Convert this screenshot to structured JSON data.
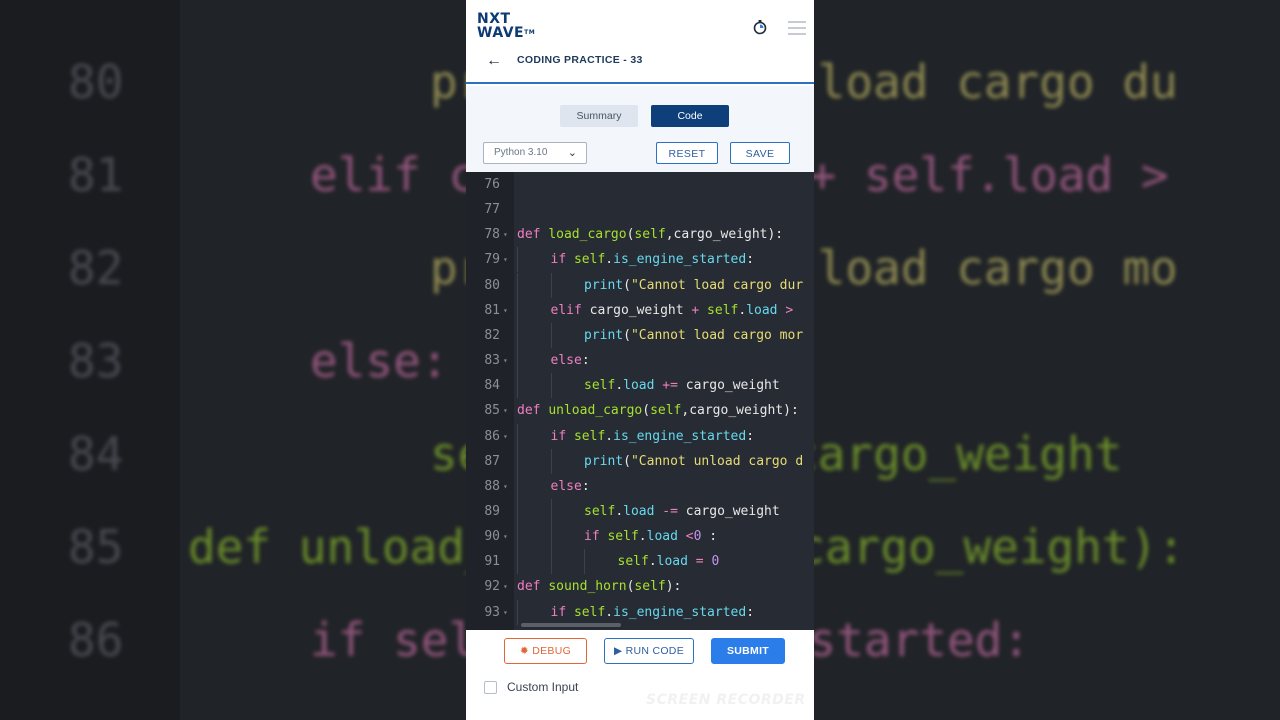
{
  "background_code": [
    {
      "num": "80",
      "code": "print(\"Cannot load cargo du"
    },
    {
      "num": "81",
      "code": "elif cargo_weight + self.load >"
    },
    {
      "num": "82",
      "code": "print(\"Cannot load cargo mo"
    },
    {
      "num": "83",
      "code": "else:"
    },
    {
      "num": "84",
      "code": "self.load += cargo_weight"
    },
    {
      "num": "85",
      "code": "def unload_cargo(self,cargo_weight):"
    },
    {
      "num": "86",
      "code": "if self.is_engine_started:"
    }
  ],
  "header": {
    "logo_top": "NXT",
    "logo_bottom": "WAVE",
    "logo_tm": "TM",
    "page_title": "CODING PRACTICE - 33"
  },
  "tabs": {
    "summary": "Summary",
    "code": "Code",
    "active": "Code"
  },
  "toolbar": {
    "language": "Python 3.10",
    "reset": "RESET",
    "save": "SAVE"
  },
  "editor": {
    "lines": [
      {
        "n": "76",
        "fold": false,
        "indent": 0,
        "tokens": []
      },
      {
        "n": "77",
        "fold": false,
        "indent": 0,
        "tokens": []
      },
      {
        "n": "78",
        "fold": true,
        "indent": 0,
        "tokens": [
          [
            "kw",
            "def "
          ],
          [
            "fn",
            "load_cargo"
          ],
          [
            "plain",
            "("
          ],
          [
            "self",
            "self"
          ],
          [
            "plain",
            ",cargo_weight):"
          ]
        ]
      },
      {
        "n": "79",
        "fold": true,
        "indent": 1,
        "tokens": [
          [
            "kw",
            "if "
          ],
          [
            "self",
            "self"
          ],
          [
            "plain",
            "."
          ],
          [
            "attr",
            "is_engine_started"
          ],
          [
            "plain",
            ":"
          ]
        ]
      },
      {
        "n": "80",
        "fold": false,
        "indent": 2,
        "tokens": [
          [
            "attr",
            "print"
          ],
          [
            "plain",
            "("
          ],
          [
            "str",
            "\"Cannot load cargo dur"
          ]
        ]
      },
      {
        "n": "81",
        "fold": true,
        "indent": 1,
        "tokens": [
          [
            "kw",
            "elif "
          ],
          [
            "plain",
            "cargo_weight "
          ],
          [
            "op",
            "+ "
          ],
          [
            "self",
            "self"
          ],
          [
            "plain",
            "."
          ],
          [
            "attr",
            "load"
          ],
          [
            "op",
            " >"
          ]
        ]
      },
      {
        "n": "82",
        "fold": false,
        "indent": 2,
        "tokens": [
          [
            "attr",
            "print"
          ],
          [
            "plain",
            "("
          ],
          [
            "str",
            "\"Cannot load cargo mor"
          ]
        ]
      },
      {
        "n": "83",
        "fold": true,
        "indent": 1,
        "tokens": [
          [
            "kw",
            "else"
          ],
          [
            "plain",
            ":"
          ]
        ]
      },
      {
        "n": "84",
        "fold": false,
        "indent": 2,
        "tokens": [
          [
            "self",
            "self"
          ],
          [
            "plain",
            "."
          ],
          [
            "attr",
            "load "
          ],
          [
            "op",
            "+= "
          ],
          [
            "plain",
            "cargo_weight"
          ]
        ]
      },
      {
        "n": "85",
        "fold": true,
        "indent": 0,
        "tokens": [
          [
            "kw",
            "def "
          ],
          [
            "fn",
            "unload_cargo"
          ],
          [
            "plain",
            "("
          ],
          [
            "self",
            "self"
          ],
          [
            "plain",
            ",cargo_weight):"
          ]
        ]
      },
      {
        "n": "86",
        "fold": true,
        "indent": 1,
        "tokens": [
          [
            "kw",
            "if "
          ],
          [
            "self",
            "self"
          ],
          [
            "plain",
            "."
          ],
          [
            "attr",
            "is_engine_started"
          ],
          [
            "plain",
            ":"
          ]
        ]
      },
      {
        "n": "87",
        "fold": false,
        "indent": 2,
        "tokens": [
          [
            "attr",
            "print"
          ],
          [
            "plain",
            "("
          ],
          [
            "str",
            "\"Cannot unload cargo d"
          ]
        ]
      },
      {
        "n": "88",
        "fold": true,
        "indent": 1,
        "tokens": [
          [
            "kw",
            "else"
          ],
          [
            "plain",
            ":"
          ]
        ]
      },
      {
        "n": "89",
        "fold": false,
        "indent": 2,
        "tokens": [
          [
            "self",
            "self"
          ],
          [
            "plain",
            "."
          ],
          [
            "attr",
            "load "
          ],
          [
            "op",
            "-= "
          ],
          [
            "plain",
            "cargo_weight"
          ]
        ]
      },
      {
        "n": "90",
        "fold": true,
        "indent": 2,
        "tokens": [
          [
            "kw",
            "if "
          ],
          [
            "self",
            "self"
          ],
          [
            "plain",
            "."
          ],
          [
            "attr",
            "load "
          ],
          [
            "op",
            "<"
          ],
          [
            "num",
            "0"
          ],
          [
            "plain",
            " :"
          ]
        ]
      },
      {
        "n": "91",
        "fold": false,
        "indent": 3,
        "tokens": [
          [
            "self",
            "self"
          ],
          [
            "plain",
            "."
          ],
          [
            "attr",
            "load "
          ],
          [
            "op",
            "= "
          ],
          [
            "num",
            "0"
          ]
        ]
      },
      {
        "n": "92",
        "fold": true,
        "indent": 0,
        "tokens": [
          [
            "kw",
            "def "
          ],
          [
            "fn",
            "sound_horn"
          ],
          [
            "plain",
            "("
          ],
          [
            "self",
            "self"
          ],
          [
            "plain",
            "):"
          ]
        ]
      },
      {
        "n": "93",
        "fold": true,
        "indent": 1,
        "tokens": [
          [
            "kw",
            "if "
          ],
          [
            "self",
            "self"
          ],
          [
            "plain",
            "."
          ],
          [
            "attr",
            "is_engine_started"
          ],
          [
            "plain",
            ":"
          ]
        ]
      }
    ]
  },
  "footer": {
    "debug": "DEBUG",
    "run_code": "RUN CODE",
    "submit": "SUBMIT",
    "custom_input": "Custom Input"
  },
  "watermark": "SCREEN RECORDER",
  "colors": {
    "brand": "#0b3a74",
    "accent": "#2b7de9",
    "debug": "#e0663a",
    "editor_bg": "#272b33"
  }
}
